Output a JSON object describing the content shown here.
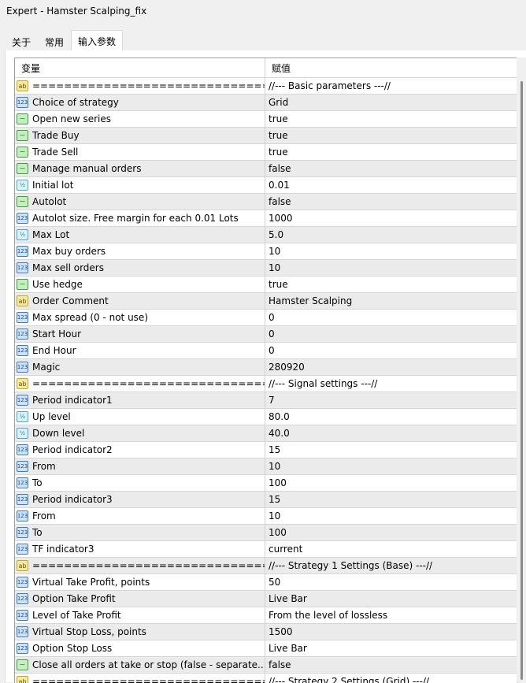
{
  "window": {
    "title": "Expert - Hamster Scalping_fix"
  },
  "tabs": [
    "关于",
    "常用",
    "输入参数"
  ],
  "columns": {
    "variable": "变量",
    "value": "赋值"
  },
  "icon_labels": {
    "int": "123",
    "dbl": "½",
    "bool": "⁓",
    "str": "ab"
  },
  "rows": [
    {
      "t": "str",
      "n": "==============================...",
      "v": "//--- Basic parameters ---//"
    },
    {
      "t": "int",
      "n": "Choice of strategy",
      "v": "Grid"
    },
    {
      "t": "bool",
      "n": "Open new series",
      "v": "true"
    },
    {
      "t": "bool",
      "n": "Trade Buy",
      "v": "true"
    },
    {
      "t": "bool",
      "n": "Trade Sell",
      "v": "true"
    },
    {
      "t": "bool",
      "n": "Manage manual orders",
      "v": "false"
    },
    {
      "t": "dbl",
      "n": "Initial lot",
      "v": "0.01"
    },
    {
      "t": "bool",
      "n": "Autolot",
      "v": "false"
    },
    {
      "t": "int",
      "n": "Autolot size. Free margin for each 0.01 Lots",
      "v": "1000"
    },
    {
      "t": "dbl",
      "n": "Max Lot",
      "v": "5.0"
    },
    {
      "t": "int",
      "n": "Max buy orders",
      "v": "10"
    },
    {
      "t": "int",
      "n": "Max sell orders",
      "v": "10"
    },
    {
      "t": "bool",
      "n": "Use hedge",
      "v": "true"
    },
    {
      "t": "str",
      "n": "Order Comment",
      "v": "Hamster Scalping"
    },
    {
      "t": "int",
      "n": "Max spread (0 - not use)",
      "v": "0"
    },
    {
      "t": "int",
      "n": "Start Hour",
      "v": "0"
    },
    {
      "t": "int",
      "n": "End Hour",
      "v": "0"
    },
    {
      "t": "int",
      "n": "Magic",
      "v": "280920"
    },
    {
      "t": "str",
      "n": "==============================...",
      "v": "//--- Signal settings ---//"
    },
    {
      "t": "int",
      "n": "Period indicator1",
      "v": "7"
    },
    {
      "t": "dbl",
      "n": "Up level",
      "v": "80.0"
    },
    {
      "t": "dbl",
      "n": "Down level",
      "v": "40.0"
    },
    {
      "t": "int",
      "n": "Period indicator2",
      "v": "15"
    },
    {
      "t": "int",
      "n": "From",
      "v": "10"
    },
    {
      "t": "int",
      "n": "To",
      "v": "100"
    },
    {
      "t": "int",
      "n": "Period indicator3",
      "v": "15"
    },
    {
      "t": "int",
      "n": "From",
      "v": "10"
    },
    {
      "t": "int",
      "n": "To",
      "v": "100"
    },
    {
      "t": "int",
      "n": "TF indicator3",
      "v": "current"
    },
    {
      "t": "str",
      "n": "==============================...",
      "v": "//--- Strategy 1 Settings (Base) ---//"
    },
    {
      "t": "int",
      "n": "Virtual Take Profit, points",
      "v": "50"
    },
    {
      "t": "int",
      "n": "Option Take Profit",
      "v": "Live Bar"
    },
    {
      "t": "int",
      "n": "Level of Take Profit",
      "v": "From the level of lossless"
    },
    {
      "t": "int",
      "n": "Virtual Stop Loss, points",
      "v": "1500"
    },
    {
      "t": "int",
      "n": "Option Stop Loss",
      "v": "Live Bar"
    },
    {
      "t": "bool",
      "n": "Close all orders at take or stop (false - separate...",
      "v": "false"
    },
    {
      "t": "str",
      "n": "==============================...",
      "v": "//--- Strategy 2 Settings (Grid) ---//"
    }
  ]
}
